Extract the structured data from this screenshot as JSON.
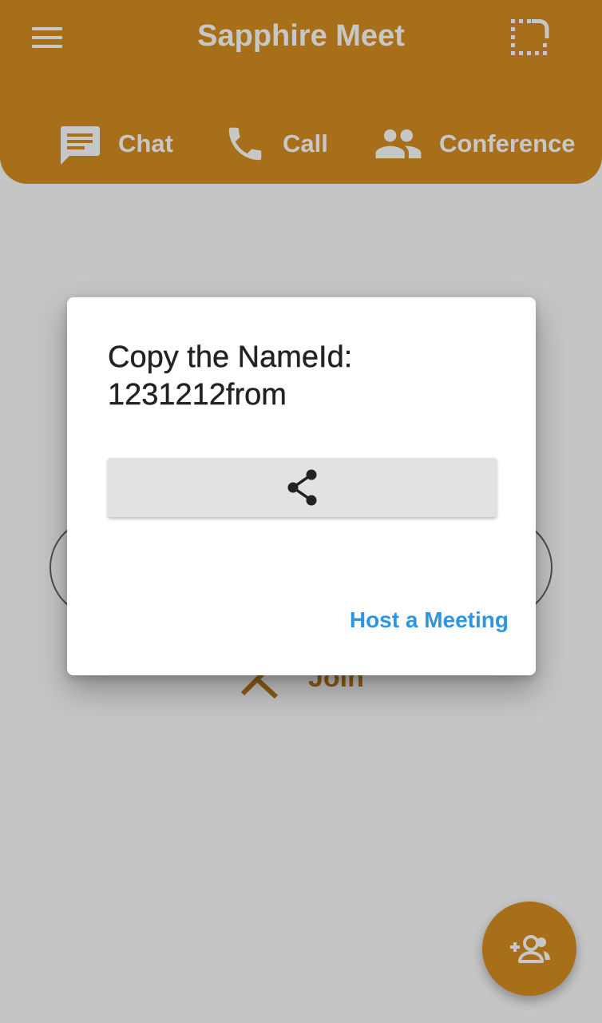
{
  "app": {
    "title": "Sapphire Meet",
    "brand_color": "#d78f20"
  },
  "header": {
    "menu_icon": "menu-icon",
    "screen_icon": "screen-select-icon"
  },
  "tabs": [
    {
      "label": "Chat",
      "icon": "chat-icon"
    },
    {
      "label": "Call",
      "icon": "phone-icon"
    },
    {
      "label": "Conference",
      "icon": "group-icon"
    }
  ],
  "background": {
    "join_label": "Join"
  },
  "dialog": {
    "title_line1": "Copy the NameId:",
    "title_line2": "1231212from",
    "share_icon": "share-icon",
    "host_link": "Host a Meeting",
    "link_color": "#2e95e0"
  },
  "fab": {
    "icon": "add-group-icon"
  }
}
